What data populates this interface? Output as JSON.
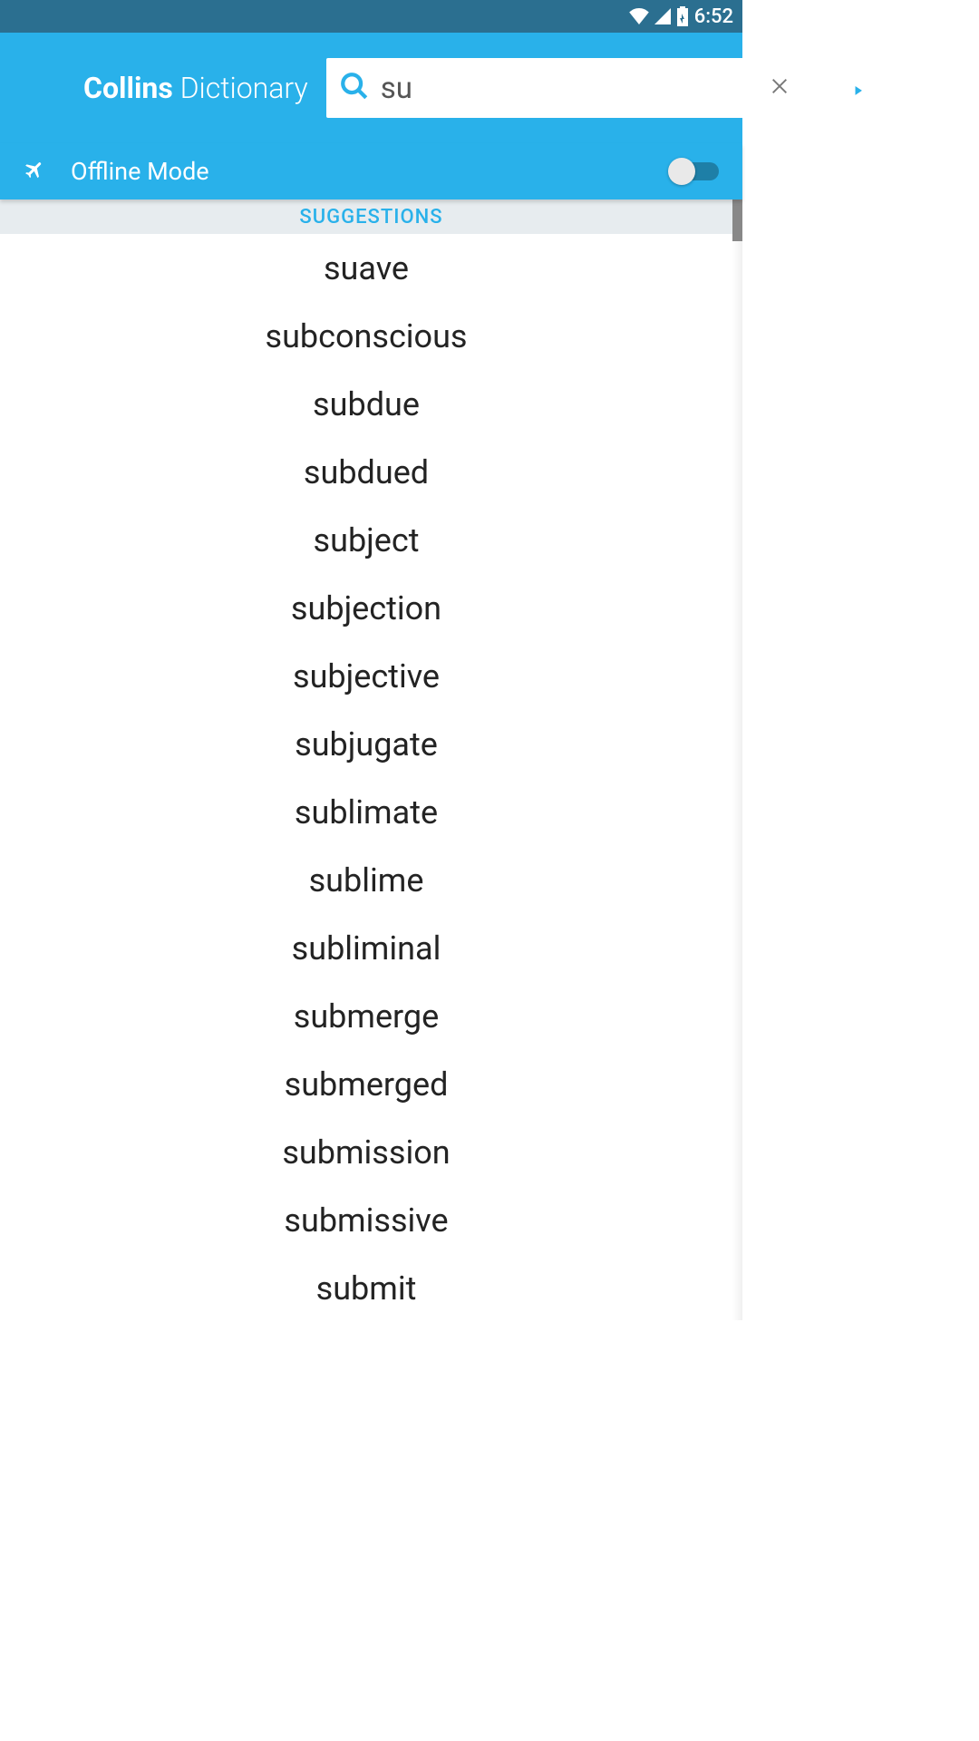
{
  "status_bar": {
    "time": "6:52"
  },
  "app_bar": {
    "title_bold": "Collins",
    "title_light": " Dictionary"
  },
  "search": {
    "value": "su"
  },
  "offline": {
    "label": "Offline Mode"
  },
  "suggestions": {
    "header": "SUGGESTIONS",
    "items": [
      "suave",
      "subconscious",
      "subdue",
      "subdued",
      "subject",
      "subjection",
      "subjective",
      "subjugate",
      "sublimate",
      "sublime",
      "subliminal",
      "submerge",
      "submerged",
      "submission",
      "submissive",
      "submit"
    ]
  }
}
